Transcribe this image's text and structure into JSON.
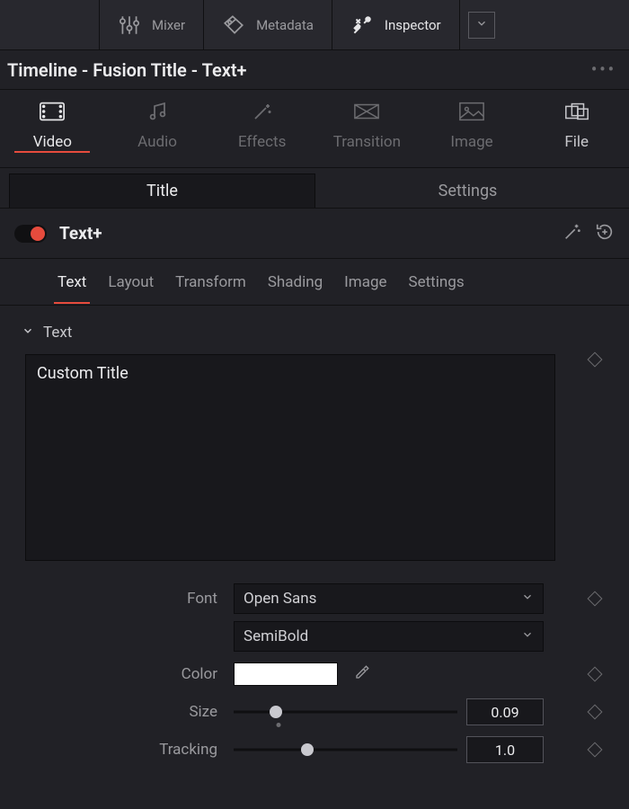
{
  "topbar": {
    "mixer": "Mixer",
    "metadata": "Metadata",
    "inspector": "Inspector"
  },
  "titlebar": "Timeline - Fusion Title - Text+",
  "categories": {
    "video": "Video",
    "audio": "Audio",
    "effects": "Effects",
    "transition": "Transition",
    "image": "Image",
    "file": "File"
  },
  "segtabs": {
    "title": "Title",
    "settings": "Settings"
  },
  "section": {
    "name": "Text+"
  },
  "subtabs": {
    "text": "Text",
    "layout": "Layout",
    "transform": "Transform",
    "shading": "Shading",
    "image": "Image",
    "settings": "Settings"
  },
  "collapse": {
    "label": "Text"
  },
  "textarea": {
    "value": "Custom Title"
  },
  "props": {
    "font_label": "Font",
    "font_family": "Open Sans",
    "font_weight": "SemiBold",
    "color_label": "Color",
    "color_value": "#ffffff",
    "size_label": "Size",
    "size_value": "0.09",
    "size_pos": 0.19,
    "size_mark": 0.2,
    "tracking_label": "Tracking",
    "tracking_value": "1.0",
    "tracking_pos": 0.33
  }
}
